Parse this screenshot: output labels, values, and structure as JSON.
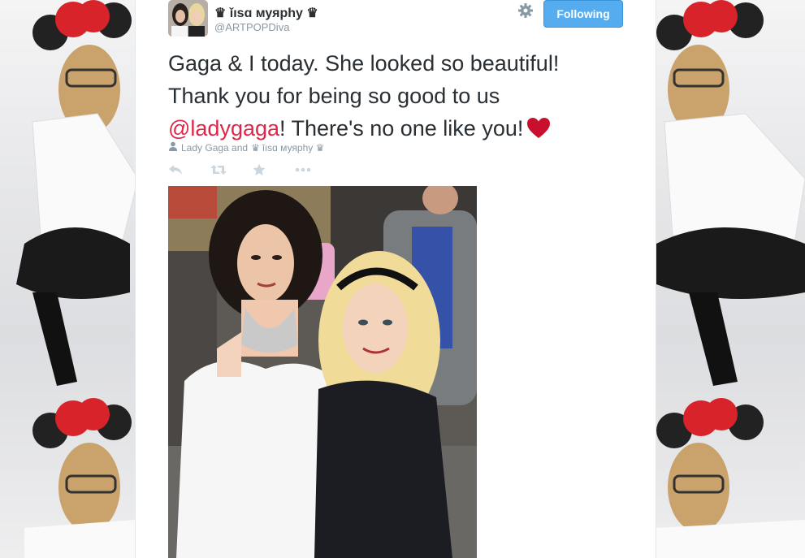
{
  "tweet": {
    "display_name": "♛ ǐısɑ муярhу ♛",
    "screen_name": "@ARTPOPDiva",
    "follow_label": "Following",
    "text_line1": "Gaga & I today. She looked so beautiful!",
    "text_line2": "Thank you for being so good to us",
    "mention": "@ladygaga",
    "text_line3": "! There's no one like you!",
    "tagged_prefix": "Lady Gaga and",
    "tagged_user": "♛ ǐısɑ муярhу ♛",
    "icons": {
      "settings": "gear-icon",
      "reply": "reply-icon",
      "retweet": "retweet-icon",
      "favorite": "star-icon",
      "more": "ellipsis-icon",
      "tag": "person-icon",
      "emoji": "red-heart-icon"
    },
    "colors": {
      "follow_button": "#55acee",
      "mention": "#e0254a",
      "muted": "#8899a6",
      "heart": "#c8102e"
    }
  }
}
